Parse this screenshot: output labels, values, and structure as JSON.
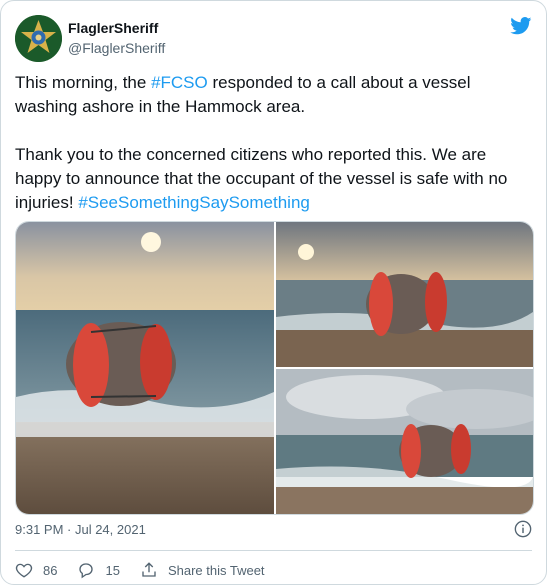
{
  "author": {
    "name": "FlaglerSheriff",
    "handle": "@FlaglerSheriff"
  },
  "tweet": {
    "p1_a": "This morning, the ",
    "p1_tag": "#FCSO",
    "p1_b": " responded to a call about a vessel washing ashore in the Hammock area.",
    "p2_a": "Thank you to the concerned citizens who reported this. We are happy to announce that the occupant of the vessel is safe with no injuries! ",
    "p2_tag": "#SeeSomethingSaySomething"
  },
  "timestamp": "9:31 PM · Jul 24, 2021",
  "actions": {
    "likes": "86",
    "replies": "15",
    "share_label": "Share this Tweet"
  },
  "colors": {
    "link": "#1d9bf0",
    "text": "#0f1419",
    "muted": "#536471",
    "twitter": "#1d9bf0"
  },
  "icons": [
    "badge-avatar-icon",
    "twitter-bird-icon",
    "info-icon",
    "heart-icon",
    "reply-icon",
    "share-icon"
  ]
}
